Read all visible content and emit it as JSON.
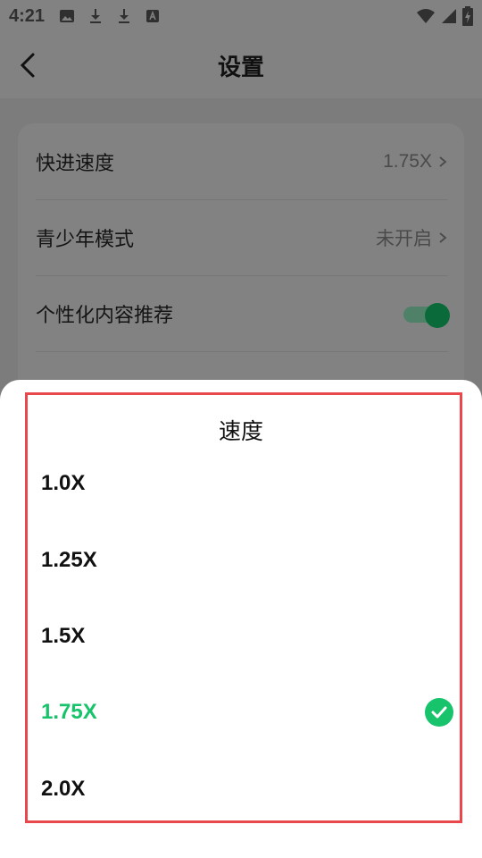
{
  "status_bar": {
    "time": "4:21",
    "left_icons": [
      "image-icon",
      "download-icon",
      "download-icon",
      "font-icon"
    ],
    "right_icons": [
      "wifi-icon",
      "signal-icon",
      "battery-icon"
    ]
  },
  "header": {
    "title": "设置"
  },
  "settings": {
    "rows": [
      {
        "label": "快进速度",
        "value": "1.75X"
      },
      {
        "label": "青少年模式",
        "value": "未开启"
      },
      {
        "label": "个性化内容推荐",
        "toggle": true
      }
    ]
  },
  "sheet": {
    "title": "速度",
    "options": [
      {
        "label": "1.0X",
        "selected": false
      },
      {
        "label": "1.25X",
        "selected": false
      },
      {
        "label": "1.5X",
        "selected": false
      },
      {
        "label": "1.75X",
        "selected": true
      },
      {
        "label": "2.0X",
        "selected": false
      }
    ]
  },
  "colors": {
    "accent": "#17c36b",
    "highlight_border": "#e8484c",
    "scrim": "#8a8a8a"
  }
}
